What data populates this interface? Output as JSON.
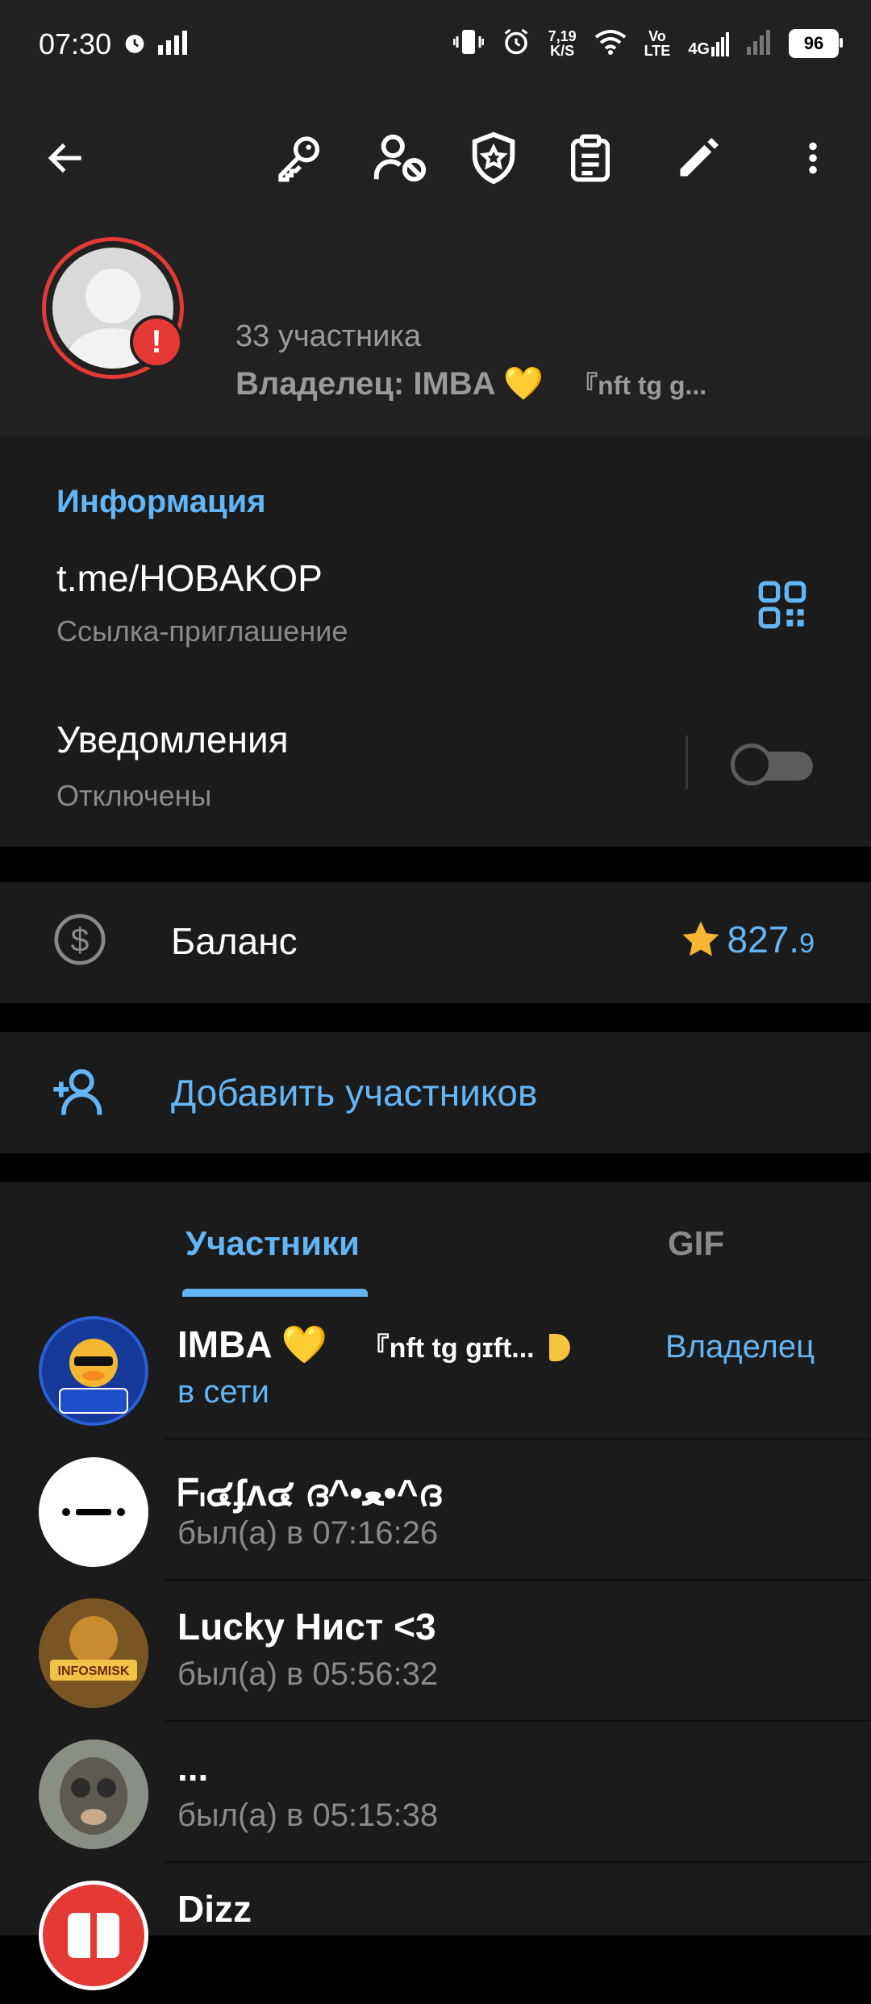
{
  "status_bar": {
    "time": "07:30",
    "speed_top": "7,19",
    "speed_bottom": "K/S",
    "vo": "Vo",
    "lte": "LTE",
    "net": "4G",
    "battery": "96"
  },
  "toolbar": {
    "icons": [
      "back-arrow-icon",
      "key-icon",
      "user-block-icon",
      "shield-star-icon",
      "clipboard-icon",
      "pencil-icon",
      "more-vert-icon"
    ]
  },
  "profile": {
    "members": "33 участника",
    "owner_label": "Владелец: IMBA 💛",
    "owner_gift": "『nft tg g..."
  },
  "info": {
    "title": "Информация",
    "link": "t.me/HOBAKOP",
    "link_sub": "Ссылка-приглашение",
    "notifications": "Уведомления",
    "notifications_sub": "Отключены",
    "notifications_on": false
  },
  "balance": {
    "label": "Баланс",
    "value": "827.",
    "decimal": "9"
  },
  "add_members": {
    "label": "Добавить участников"
  },
  "tabs": [
    {
      "label": "Участники",
      "active": true
    },
    {
      "label": "GIF",
      "active": false
    }
  ],
  "members": [
    {
      "name": "IMBA 💛",
      "gift": "『nft tg gɪft...",
      "status": "в сети",
      "role": "Владелец",
      "online": true
    },
    {
      "name": "ᖴ៲๔ʄʌ๔   ദ^•ﻌ•^ദ",
      "status": "был(а) в 07:16:26"
    },
    {
      "name": "Lucky Нист <3",
      "status": "был(а) в 05:56:32"
    },
    {
      "name": "...",
      "status": "был(а) в 05:15:38"
    },
    {
      "name": "Dizz",
      "status": ""
    }
  ],
  "colors": {
    "accent": "#64b5f6",
    "header_bg": "#212121",
    "card_bg": "#1b1b1b",
    "warning": "#e53935"
  }
}
